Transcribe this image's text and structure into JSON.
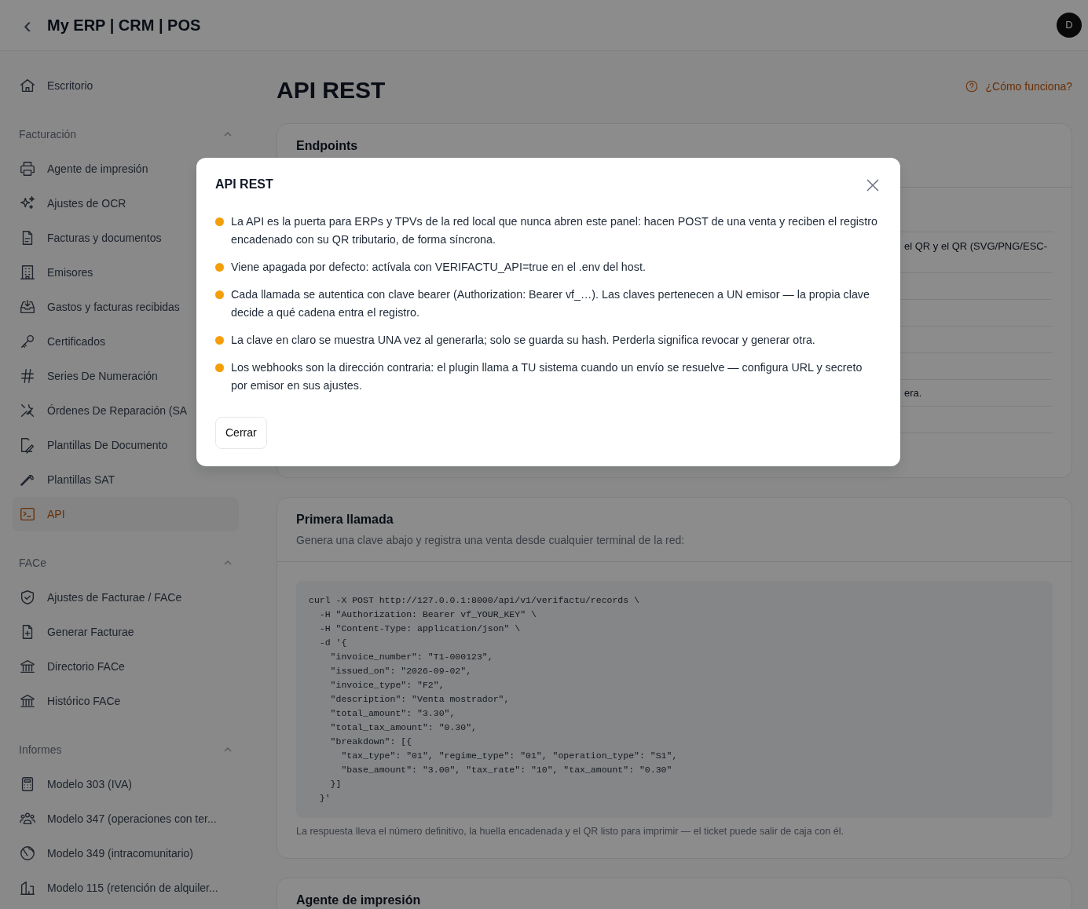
{
  "header": {
    "back_label": "‹",
    "title": "My ERP | CRM | POS",
    "avatar": "D"
  },
  "sidebar": {
    "top_items": [
      {
        "label": "Escritorio",
        "selected": false
      }
    ],
    "groups": [
      {
        "title": "Facturación",
        "expanded": true,
        "items": [
          {
            "label": "Agente de impresión",
            "selected": false
          },
          {
            "label": "Ajustes de OCR",
            "selected": false
          },
          {
            "label": "Facturas y documentos",
            "selected": false
          },
          {
            "label": "Emisores",
            "selected": false
          },
          {
            "label": "Gastos y facturas recibidas",
            "selected": false
          },
          {
            "label": "Certificados",
            "selected": false
          },
          {
            "label": "Series De Numeración",
            "selected": false
          },
          {
            "label": "Órdenes De Reparación (SA",
            "selected": false
          },
          {
            "label": "Plantillas De Documento",
            "selected": false
          },
          {
            "label": "Plantillas SAT",
            "selected": false
          },
          {
            "label": "API",
            "selected": true
          }
        ]
      },
      {
        "title": "FACe",
        "expanded": true,
        "items": [
          {
            "label": "Ajustes de Facturae / FACe",
            "selected": false
          },
          {
            "label": "Generar Facturae",
            "selected": false
          },
          {
            "label": "Directorio FACe",
            "selected": false
          },
          {
            "label": "Histórico FACe",
            "selected": false
          }
        ]
      },
      {
        "title": "Informes",
        "expanded": true,
        "items": [
          {
            "label": "Modelo 303 (IVA)",
            "selected": false
          },
          {
            "label": "Modelo 347 (operaciones con ter...",
            "selected": false
          },
          {
            "label": "Modelo 349 (intracomunitario)",
            "selected": false
          },
          {
            "label": "Modelo 115 (retención de alquiler...",
            "selected": false
          }
        ]
      }
    ]
  },
  "page": {
    "title": "API REST",
    "help_link": "¿Cómo funciona?",
    "endpoints": {
      "title": "Endpoints",
      "rows": [
        {
          "text": "el QR y el QR (SVG/PNG/ESC-"
        },
        {},
        {},
        {},
        {},
        {
          "text": "era."
        },
        {}
      ]
    },
    "first_call": {
      "title": "Primera llamada",
      "subtitle": "Genera una clave abajo y registra una venta desde cualquier terminal de la red:",
      "code": "curl -X POST http://127.0.0.1:8000/api/v1/verifactu/records \\\n  -H \"Authorization: Bearer vf_YOUR_KEY\" \\\n  -H \"Content-Type: application/json\" \\\n  -d '{\n    \"invoice_number\": \"T1-000123\",\n    \"issued_on\": \"2026-09-02\",\n    \"invoice_type\": \"F2\",\n    \"description\": \"Venta mostrador\",\n    \"total_amount\": \"3.30\",\n    \"total_tax_amount\": \"0.30\",\n    \"breakdown\": [{\n      \"tax_type\": \"01\", \"regime_type\": \"01\", \"operation_type\": \"S1\",\n      \"base_amount\": \"3.00\", \"tax_rate\": \"10\", \"tax_amount\": \"0.30\"\n    }]\n  }'",
      "note": "La respuesta lleva el número definitivo, la huella encadenada y el QR listo para imprimir — el ticket puede salir de caja con él."
    },
    "print_agent": {
      "title": "Agente de impresión"
    }
  },
  "modal": {
    "title": "API REST",
    "items": [
      "La API es la puerta para ERPs y TPVs de la red local que nunca abren este panel: hacen POST de una venta y reciben el registro encadenado con su QR tributario, de forma síncrona.",
      "Viene apagada por defecto: actívala con VERIFACTU_API=true en el .env del host.",
      "Cada llamada se autentica con clave bearer (Authorization: Bearer vf_…). Las claves pertenecen a UN emisor — la propia clave decide a qué cadena entra el registro.",
      "La clave en claro se muestra UNA vez al generarla; solo se guarda su hash. Perderla significa revocar y generar otra.",
      "Los webhooks son la dirección contraria: el plugin llama a TU sistema cuando un envío se resuelve — configura URL y secreto por emisor en sus ajustes."
    ],
    "close_button": "Cerrar"
  }
}
